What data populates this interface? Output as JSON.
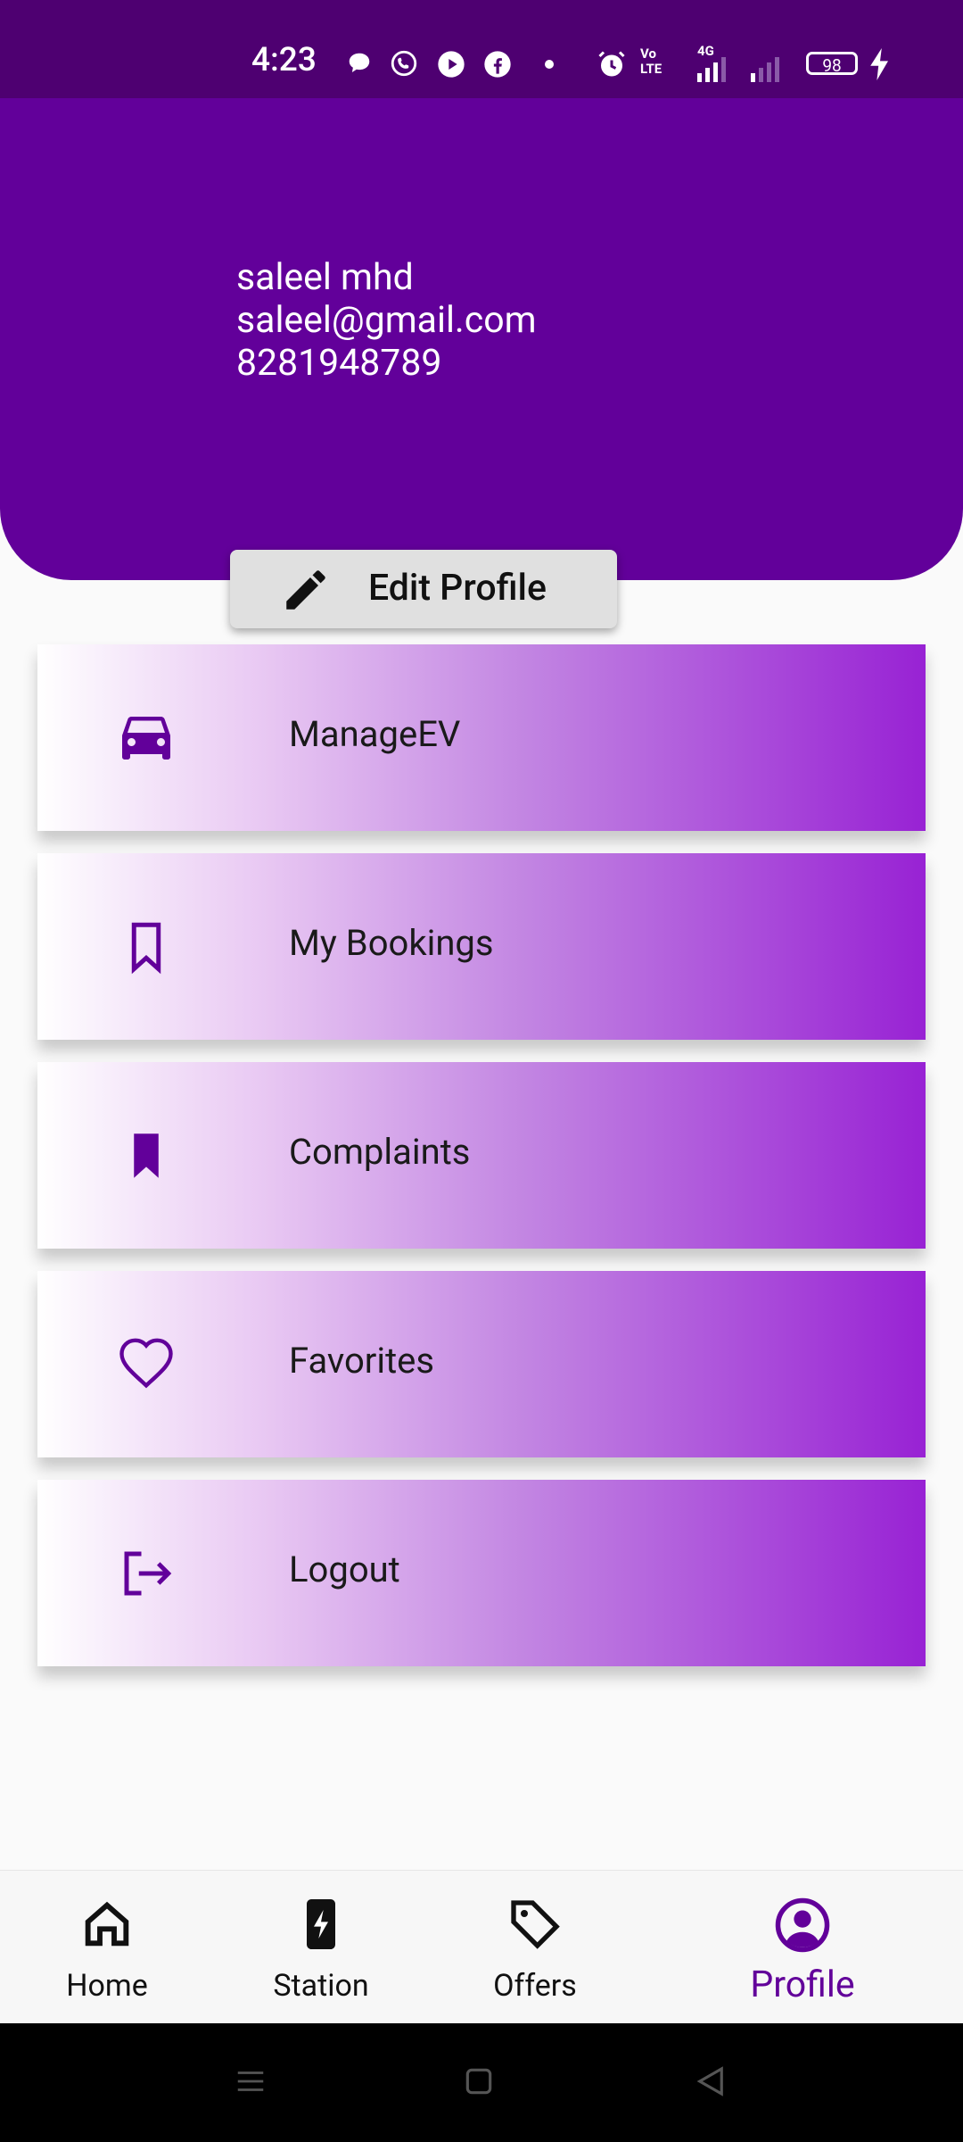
{
  "status_bar": {
    "time": "4:23",
    "battery": "98",
    "network": "4G",
    "volte": "Vo LTE"
  },
  "profile": {
    "name": "saleel mhd",
    "email": "saleel@gmail.com",
    "phone": "8281948789",
    "edit_label": "Edit Profile"
  },
  "menu": [
    {
      "label": "ManageEV",
      "icon": "car-icon"
    },
    {
      "label": "My Bookings",
      "icon": "bookmark-outline-icon"
    },
    {
      "label": "Complaints",
      "icon": "bookmark-filled-icon"
    },
    {
      "label": "Favorites",
      "icon": "heart-icon"
    },
    {
      "label": "Logout",
      "icon": "logout-icon"
    }
  ],
  "nav": [
    {
      "label": "Home",
      "icon": "home-icon"
    },
    {
      "label": "Station",
      "icon": "charging-station-icon"
    },
    {
      "label": "Offers",
      "icon": "tag-icon"
    },
    {
      "label": "Profile",
      "icon": "account-circle-icon",
      "active": true
    }
  ],
  "colors": {
    "primary": "#62009a",
    "status_bar": "#4e0071",
    "gradient_end": "#9822d4"
  }
}
